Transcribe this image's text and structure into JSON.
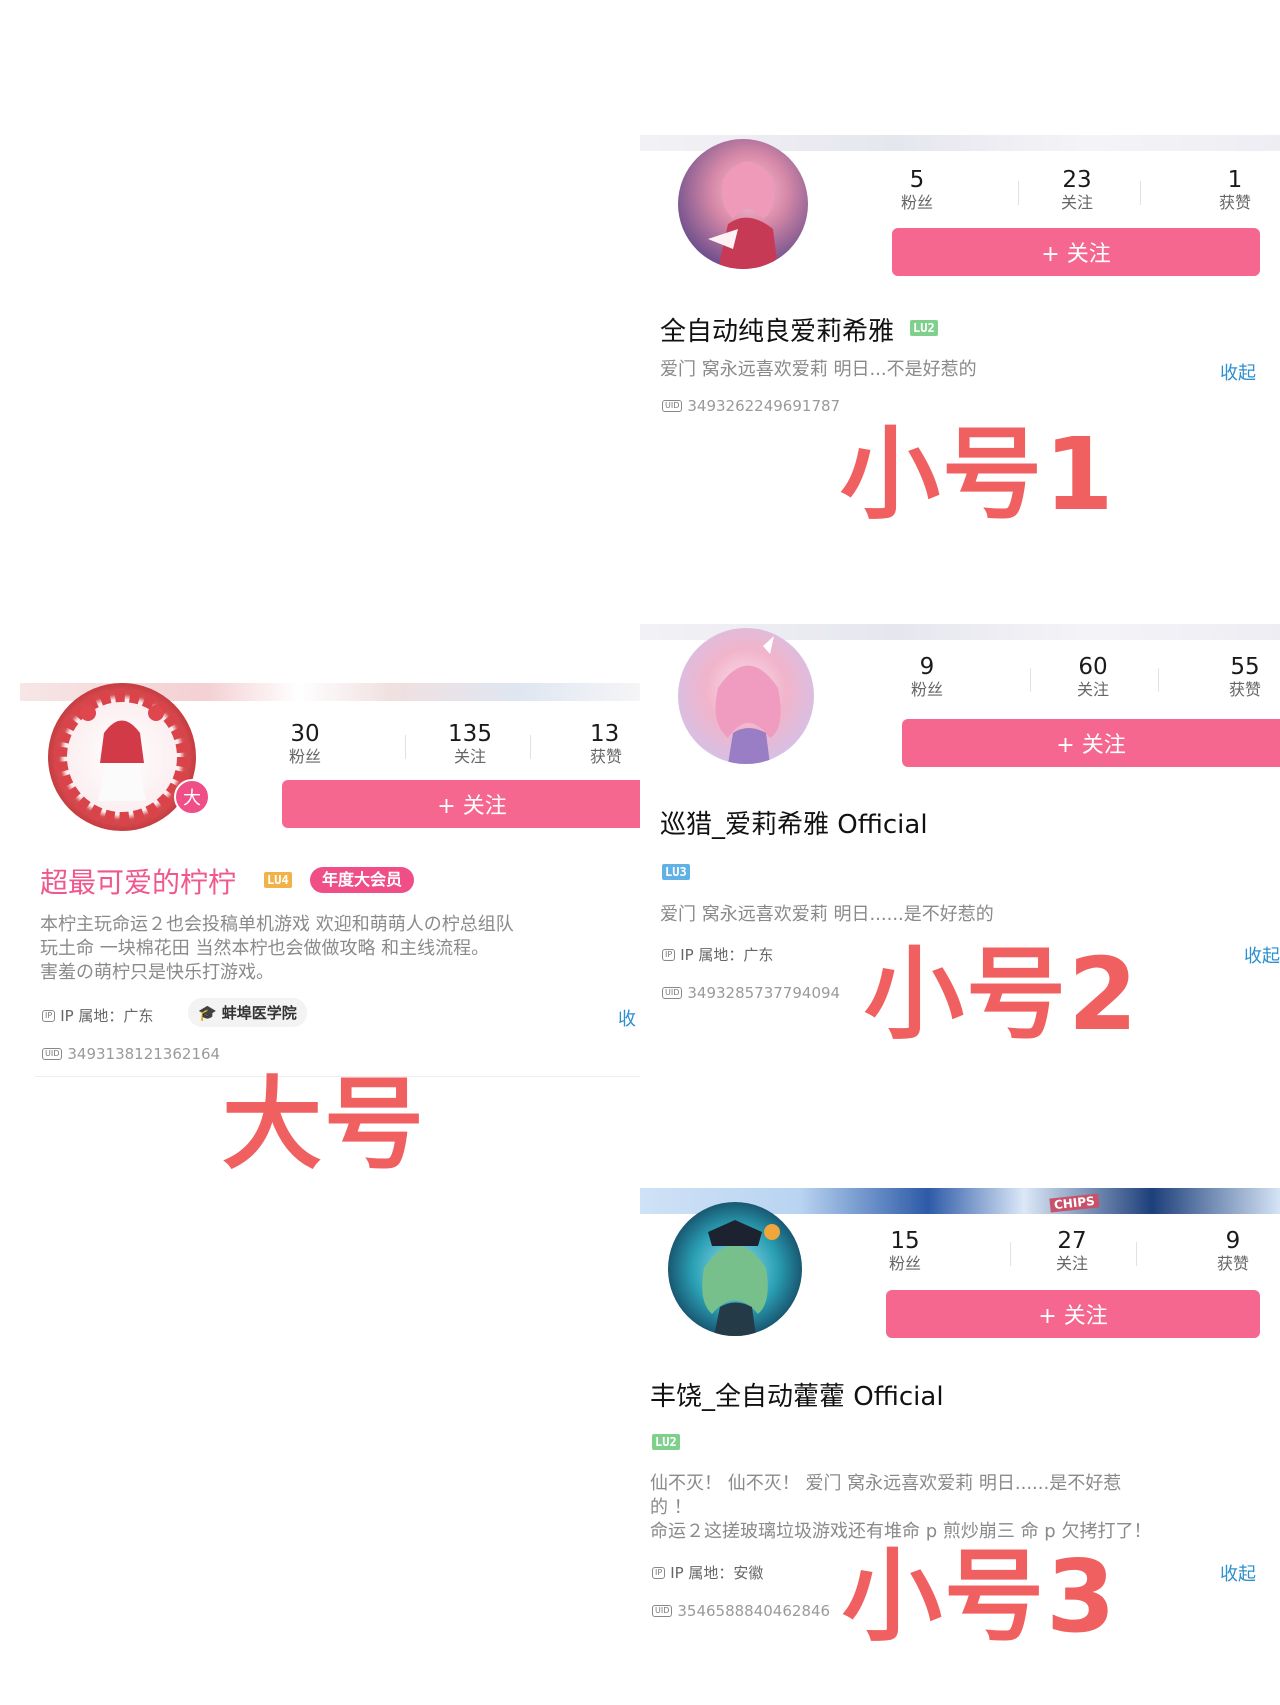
{
  "colors": {
    "accent": "#f5678f",
    "label": "#f06060",
    "link": "#2c8fcf",
    "lv2": "#7fd08d",
    "lv3": "#5fb1e6",
    "lv4": "#f2b24a",
    "vip": "#ef4e86"
  },
  "cards": {
    "alt1": {
      "avatar_icon": "anime-girl-avatar-icon",
      "stats": [
        {
          "num": "5",
          "label": "粉丝"
        },
        {
          "num": "23",
          "label": "关注"
        },
        {
          "num": "1",
          "label": "获赞"
        }
      ],
      "follow_label": "+ 关注",
      "name": "全自动纯良爱莉希雅",
      "level": "LU2",
      "bio": "爱门  窝永远喜欢爱莉  明日...不是好惹的",
      "collapse": "收起",
      "uid": "3493262249691787",
      "overlay_label": "小号1"
    },
    "main": {
      "avatar_icon": "wreath-girl-avatar-icon",
      "avatar_badge": "大",
      "stats": [
        {
          "num": "30",
          "label": "粉丝"
        },
        {
          "num": "135",
          "label": "关注"
        },
        {
          "num": "13",
          "label": "获赞"
        }
      ],
      "follow_label": "+ 关注",
      "name": "超最可爱的柠柠",
      "level": "LU4",
      "vip_badge": "年度大会员",
      "bio_lines": [
        "本柠主玩命运２也会投稿单机游戏 欢迎和萌萌人の柠总组队",
        "玩土命 一块棉花田  当然本柠也会做做攻略 和主线流程。",
        "害羞の萌柠只是快乐打游戏。"
      ],
      "ip": "IP 属地：广东",
      "school": "蚌埠医学院",
      "collapse": "收",
      "uid": "3493138121362164",
      "overlay_label": "大号"
    },
    "alt2": {
      "avatar_icon": "pink-hair-girl-avatar-icon",
      "stats": [
        {
          "num": "9",
          "label": "粉丝"
        },
        {
          "num": "60",
          "label": "关注"
        },
        {
          "num": "55",
          "label": "获赞"
        }
      ],
      "follow_label": "+ 关注",
      "name": "巡猎_爱莉希雅 Official",
      "level": "LU3",
      "bio": "爱门  窝永远喜欢爱莉  明日......是不好惹的",
      "ip": "IP 属地：广东",
      "collapse": "收起",
      "uid": "3493285737794094",
      "overlay_label": "小号2"
    },
    "alt3": {
      "avatar_icon": "green-hair-girl-avatar-icon",
      "stats": [
        {
          "num": "15",
          "label": "粉丝"
        },
        {
          "num": "27",
          "label": "关注"
        },
        {
          "num": "9",
          "label": "获赞"
        }
      ],
      "follow_label": "+ 关注",
      "name": "丰饶_全自动藿藿 Official",
      "level": "LU2",
      "bio_lines": [
        "仙不灭！ 仙不灭！ 爱门  窝永远喜欢爱莉  明日......是不好惹",
        "的  ！",
        "命运２这搓玻璃垃圾游戏还有堆命 p 煎炒崩三 命 p 欠拷打了！"
      ],
      "ip": "IP 属地：安徽",
      "collapse": "收起",
      "uid": "3546588840462846",
      "overlay_label": "小号3",
      "banner_text": "CHIPS"
    }
  }
}
